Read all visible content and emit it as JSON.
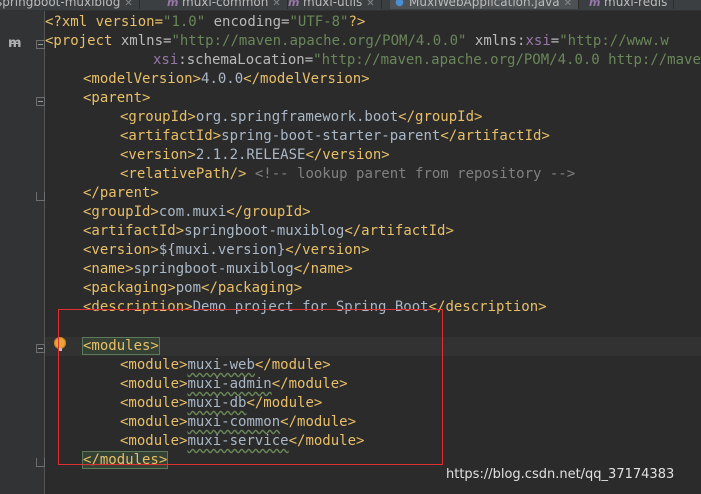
{
  "tabs": [
    {
      "label": "springboot-muxiblog",
      "icon": "maven-icon",
      "active": false
    },
    {
      "label": "muxi-common",
      "icon": "maven-icon",
      "active": false
    },
    {
      "label": "muxi-utils",
      "icon": "maven-icon",
      "active": false
    },
    {
      "label": "MuxiWebApplication.java",
      "icon": "java-class-icon",
      "active": true
    },
    {
      "label": "muxi-redis",
      "icon": "maven-icon",
      "active": false
    }
  ],
  "code": {
    "l1": {
      "open": "<?xml version=",
      "ver": "\"1.0\"",
      "enc_attr": " encoding=",
      "enc": "\"UTF-8\"",
      "close": "?>"
    },
    "l2": {
      "open": "<project",
      "xmlns_attr": " xmlns=",
      "xmlns_val": "\"http://maven.apache.org/POM/4.0.0\"",
      "xsi_pre": " xmlns:",
      "xsi": "xsi",
      "eq": "=",
      "xsi_val": "\"http://www.w"
    },
    "l3": {
      "xsi": "xsi",
      "attr": ":schemaLocation=",
      "val": "\"http://maven.apache.org/POM/4.0.0 http://mave"
    },
    "l4": {
      "open": "<modelVersion>",
      "text": "4.0.0",
      "close": "</modelVersion>"
    },
    "l5": {
      "open": "<parent>"
    },
    "l6": {
      "open": "<groupId>",
      "text": "org.springframework.boot",
      "close": "</groupId>"
    },
    "l7": {
      "open": "<artifactId>",
      "text": "spring-boot-starter-parent",
      "close": "</artifactId>"
    },
    "l8": {
      "open": "<version>",
      "text": "2.1.2.RELEASE",
      "close": "</version>"
    },
    "l9": {
      "open": "<relativePath/>",
      "comment": " <!-- lookup parent from repository -->"
    },
    "l10": {
      "close": "</parent>"
    },
    "l11": {
      "open": "<groupId>",
      "text": "com.muxi",
      "close": "</groupId>"
    },
    "l12": {
      "open": "<artifactId>",
      "text": "springboot-muxiblog",
      "close": "</artifactId>"
    },
    "l13": {
      "open": "<version>",
      "text": "${muxi.version}",
      "close": "</version>"
    },
    "l14": {
      "open": "<name>",
      "text": "springboot-muxiblog",
      "close": "</name>"
    },
    "l15": {
      "open": "<packaging>",
      "text": "pom",
      "close": "</packaging>"
    },
    "l16": {
      "open": "<description>",
      "text": "Demo project for Spring Boot",
      "close": "</description>"
    },
    "l18": {
      "open": "<modules>"
    },
    "modules": [
      {
        "open": "<module>",
        "text": "muxi-web",
        "close": "</module>"
      },
      {
        "open": "<module>",
        "text": "muxi-admin",
        "close": "</module>"
      },
      {
        "open": "<module>",
        "text": "muxi-db",
        "close": "</module>"
      },
      {
        "open": "<module>",
        "text": "muxi-common",
        "close": "</module>"
      },
      {
        "open": "<module>",
        "text": "muxi-service",
        "close": "</module>"
      }
    ],
    "l24": {
      "close": "</modules>"
    }
  },
  "watermark": "https://blog.csdn.net/qq_37174383",
  "colors": {
    "tag": "#e8bf6a",
    "string": "#6a8759",
    "comment": "#808080",
    "annotation_box": "#e03030"
  }
}
